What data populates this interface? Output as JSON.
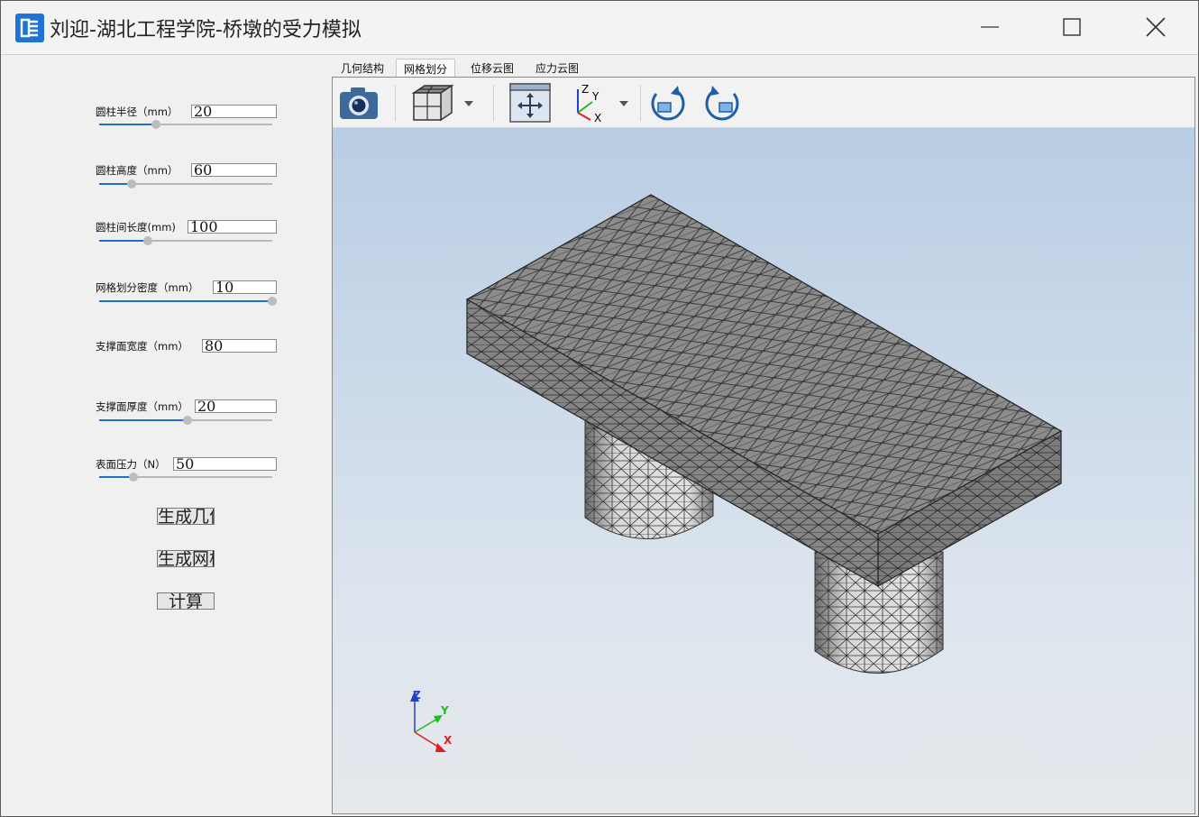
{
  "window": {
    "title": "刘迎-湖北工程学院-桥墩的受力模拟",
    "app_icon": "app-logo-icon",
    "controls": [
      "minimize-icon",
      "maximize-icon",
      "close-icon"
    ]
  },
  "params": [
    {
      "label": "圆柱半径（mm）",
      "value": "20",
      "slider_fraction": 0.33
    },
    {
      "label": "圆柱高度（mm）",
      "value": "60",
      "slider_fraction": 0.19
    },
    {
      "label": "圆柱间长度(mm)",
      "value": "100",
      "slider_fraction": 0.28
    },
    {
      "label": "网格划分密度（mm）",
      "value": "10",
      "slider_fraction": 1.0
    },
    {
      "label": "支撑面宽度（mm）",
      "value": "80",
      "slider_fraction": null
    },
    {
      "label": "支撑面厚度（mm）",
      "value": "20",
      "slider_fraction": 0.51
    },
    {
      "label": "表面压力（N）",
      "value": "50",
      "slider_fraction": 0.2
    }
  ],
  "buttons": {
    "generate_geometry": "生成几何",
    "generate_mesh": "生成网格",
    "calculate": "计算"
  },
  "tabs": [
    {
      "label": "几何结构",
      "active": false
    },
    {
      "label": "网格划分",
      "active": true
    },
    {
      "label": "位移云图",
      "active": false
    },
    {
      "label": "应力云图",
      "active": false
    }
  ],
  "toolbar": [
    "camera-icon",
    "mesh-view-icon",
    "fit-all-icon",
    "axis-view-icon",
    "rotate-clockwise-icon",
    "rotate-counterclockwise-icon"
  ],
  "triad": {
    "x": "X",
    "y": "Y",
    "z": "Z"
  },
  "colors": {
    "accent": "#1f6fcf",
    "mesh_face": "#8c8c8c",
    "mesh_light": "#d2d2d2",
    "axis_x": "#e02020",
    "axis_y": "#22bb22",
    "axis_z": "#2040d0"
  }
}
